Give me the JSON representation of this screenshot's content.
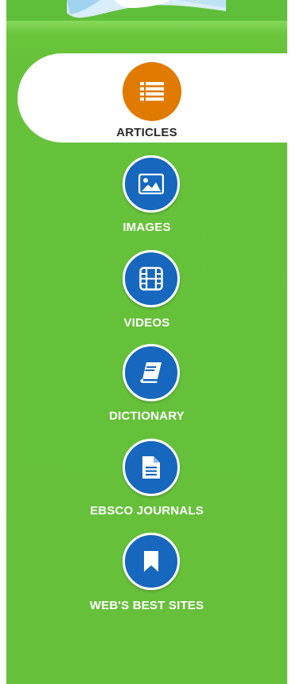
{
  "nav": {
    "items": [
      {
        "label": "ARTICLES",
        "icon": "list-icon",
        "selected": true
      },
      {
        "label": "IMAGES",
        "icon": "image-icon",
        "selected": false
      },
      {
        "label": "VIDEOS",
        "icon": "film-icon",
        "selected": false
      },
      {
        "label": "DICTIONARY",
        "icon": "book-icon",
        "selected": false
      },
      {
        "label": "EBSCO JOURNALS",
        "icon": "document-icon",
        "selected": false
      },
      {
        "label": "WEB'S BEST SITES",
        "icon": "bookmark-icon",
        "selected": false
      }
    ]
  },
  "colors": {
    "panel_green": "#66c03a",
    "selected_tab": "#ffffff",
    "active_circle": "#e07a00",
    "circle_blue": "#1667bd",
    "label_active": "#2b2b2b",
    "label_inactive": "#ffffff"
  }
}
